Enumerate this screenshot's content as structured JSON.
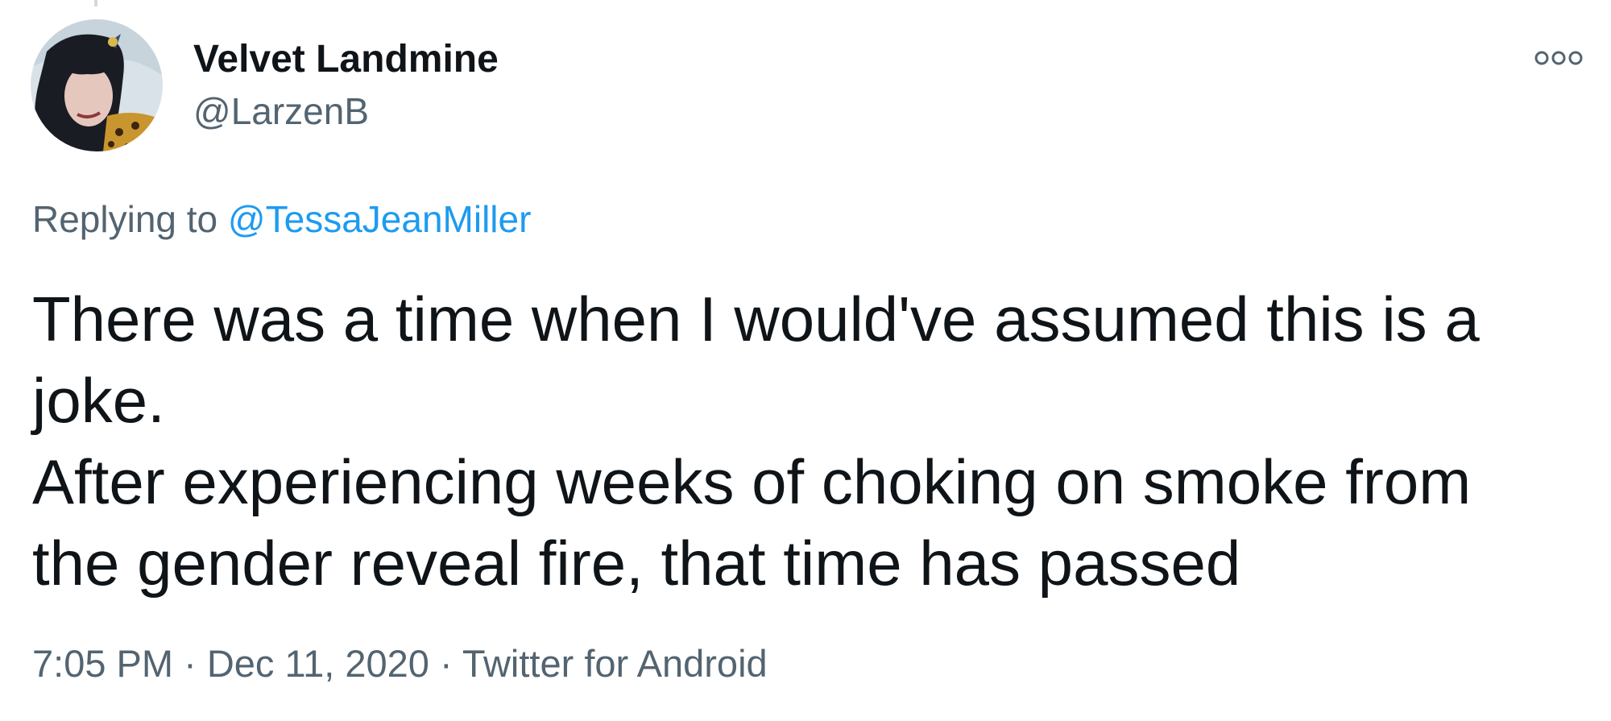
{
  "author": {
    "name": "Velvet Landmine",
    "handle": "@LarzenB"
  },
  "reply": {
    "prefix": "Replying to",
    "mention": "@TessaJeanMiller"
  },
  "tweet": {
    "lines": [
      "There was a time when I would've assumed this is a",
      "joke.",
      "After experiencing weeks of choking on smoke from",
      "the gender reveal fire, that time has passed"
    ]
  },
  "meta": {
    "time": "7:05 PM",
    "separator": "·",
    "date": "Dec 11, 2020",
    "source": "Twitter for Android"
  },
  "icons": {
    "more": "more-options-icon"
  },
  "colors": {
    "text": "#0f1419",
    "secondary": "#536471",
    "link": "#1d9bf0"
  }
}
